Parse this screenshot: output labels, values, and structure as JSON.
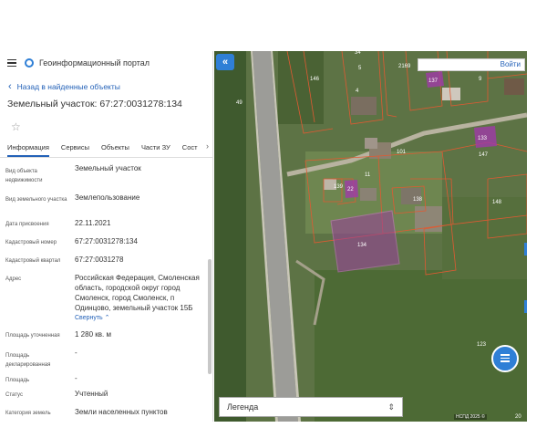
{
  "app": {
    "title": "Геоинформационный портал"
  },
  "panel": {
    "back_label": "Назад в найденные объекты",
    "object_title": "Земельный участок: 67:27:0031278:134",
    "tabs": [
      "Информация",
      "Сервисы",
      "Объекты",
      "Части ЗУ",
      "Сост"
    ],
    "active_tab": "Информация",
    "rows": [
      {
        "label": "Вид объекта недвижимости",
        "value": "Земельный участок"
      },
      {
        "label": "Вид земельного участка",
        "value": "Землепользование"
      },
      {
        "label": "Дата присвоения",
        "value": "22.11.2021"
      },
      {
        "label": "Кадастровый номер",
        "value": "67:27:0031278:134"
      },
      {
        "label": "Кадастровый квартал",
        "value": "67:27:0031278"
      },
      {
        "label": "Адрес",
        "value": "Российская Федерация, Смоленская область, городской округ город Смоленск, город Смоленск, п Одинцово, земельный участок 15Б",
        "expand": "Свернуть"
      },
      {
        "label": "Площадь уточненная",
        "value": "1 280 кв. м"
      },
      {
        "label": "Площадь декларированная",
        "value": "-"
      },
      {
        "label": "Площадь",
        "value": "-"
      },
      {
        "label": "Статус",
        "value": "Учтенный"
      },
      {
        "label": "Категория земель",
        "value": "Земли населенных пунктов"
      }
    ]
  },
  "map": {
    "collapse_label": "«",
    "search": {
      "button_label": "Войти"
    },
    "legend_label": "Легенда",
    "attribution": "НСПД 2025 ©",
    "plot_labels": [
      "146",
      "34",
      "5",
      "4",
      "2169",
      "137",
      "9",
      "133",
      "147",
      "49",
      "101",
      "11",
      "139",
      "22",
      "138",
      "148",
      "134",
      "123",
      "20"
    ],
    "highlight_color": "#a03aa8"
  }
}
